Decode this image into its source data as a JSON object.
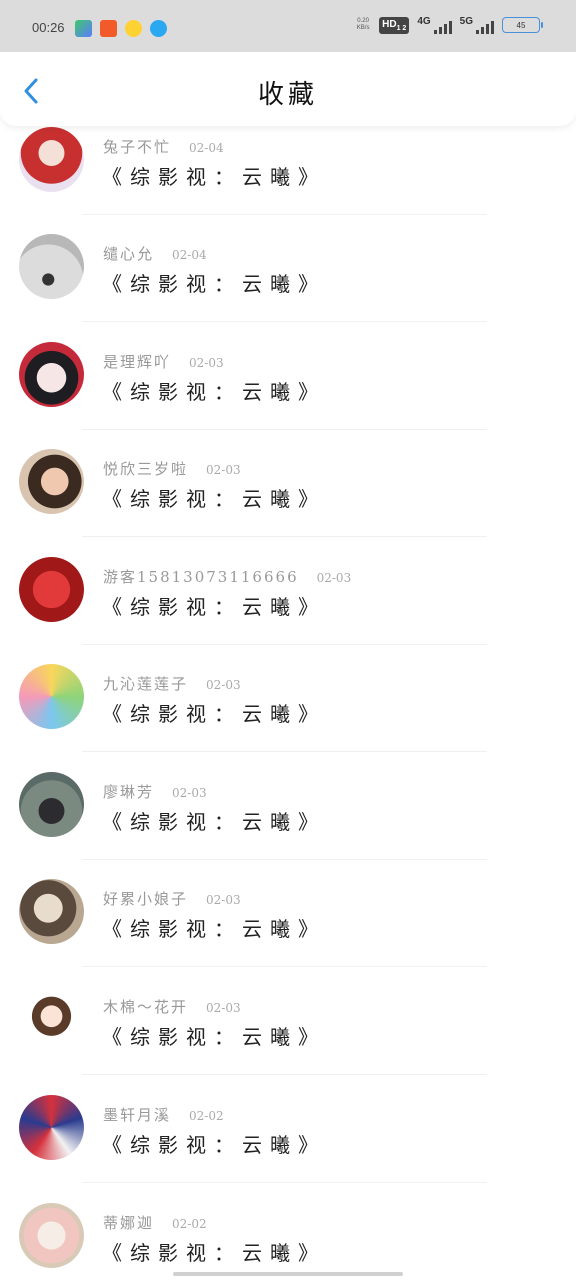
{
  "status_bar": {
    "time": "00:26",
    "net_speed": [
      "0.20",
      "KB/s"
    ],
    "hd": "HD",
    "hd_sub": "1 2",
    "sig1": "4G",
    "sig2": "5G",
    "battery": "45"
  },
  "header": {
    "title": "收藏",
    "back_icon": "chevron-left-icon"
  },
  "items": [
    {
      "user": "兔子不忙",
      "date": "02-04",
      "book": "《综影视：云曦》"
    },
    {
      "user": "缱心允",
      "date": "02-04",
      "book": "《综影视：云曦》"
    },
    {
      "user": "是理辉吖",
      "date": "02-03",
      "book": "《综影视：云曦》"
    },
    {
      "user": "悦欣三岁啦",
      "date": "02-03",
      "book": "《综影视：云曦》"
    },
    {
      "user": "游客15813073116666",
      "date": "02-03",
      "book": "《综影视：云曦》"
    },
    {
      "user": "九沁莲莲子",
      "date": "02-03",
      "book": "《综影视：云曦》"
    },
    {
      "user": "廖琳芳",
      "date": "02-03",
      "book": "《综影视：云曦》"
    },
    {
      "user": "好累小娘子",
      "date": "02-03",
      "book": "《综影视：云曦》"
    },
    {
      "user": "木棉～花开",
      "date": "02-03",
      "book": "《综影视：云曦》"
    },
    {
      "user": "墨轩月溪",
      "date": "02-02",
      "book": "《综影视：云曦》"
    },
    {
      "user": "蒂娜迦",
      "date": "02-02",
      "book": "《综影视：云曦》"
    }
  ],
  "colors": {
    "accent": "#2f8fe0",
    "status_bar_bg": "#dcdcdc",
    "username": "#999999",
    "book_title": "#222222"
  }
}
